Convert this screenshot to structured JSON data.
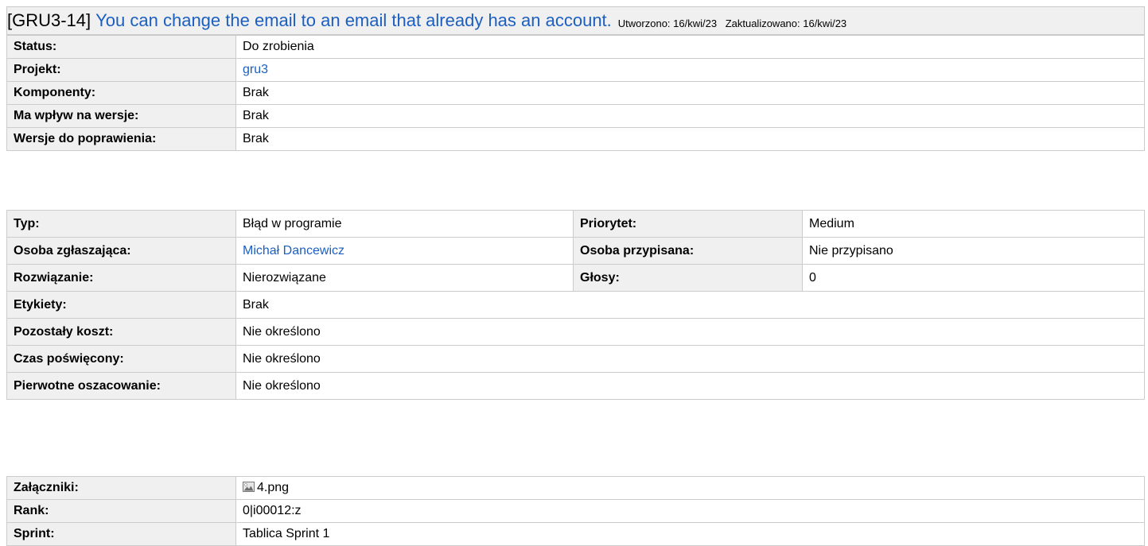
{
  "issue": {
    "key": "[GRU3-14]",
    "summary": "You can change the email to an email that already has an account.",
    "created": "Utworzono: 16/kwi/23",
    "updated": "Zaktualizowano: 16/kwi/23"
  },
  "main_fields": [
    {
      "label": "Status:",
      "value": "Do zrobienia"
    },
    {
      "label": "Projekt:",
      "value": "gru3"
    },
    {
      "label": "Komponenty:",
      "value": "Brak"
    },
    {
      "label": "Ma wpływ na wersje:",
      "value": "Brak"
    },
    {
      "label": "Wersje do poprawienia:",
      "value": "Brak"
    }
  ],
  "details": {
    "typ": {
      "label": "Typ:",
      "value": "Błąd w programie"
    },
    "priorytet": {
      "label": "Priorytet:",
      "value": "Medium"
    },
    "reporter": {
      "label": "Osoba zgłaszająca:",
      "value": "Michał Dancewicz"
    },
    "assignee": {
      "label": "Osoba przypisana:",
      "value": "Nie przypisano"
    },
    "resolution": {
      "label": "Rozwiązanie:",
      "value": "Nierozwiązane"
    },
    "votes": {
      "label": "Głosy:",
      "value": "0"
    },
    "labels": {
      "label": "Etykiety:",
      "value": "Brak"
    },
    "remaining": {
      "label": "Pozostały koszt:",
      "value": "Nie określono"
    },
    "spent": {
      "label": "Czas poświęcony:",
      "value": "Nie określono"
    },
    "original": {
      "label": "Pierwotne oszacowanie:",
      "value": "Nie określono"
    }
  },
  "extra": {
    "attachments": {
      "label": "Załączniki:",
      "value": "4.png",
      "icon": "image-icon"
    },
    "rank": {
      "label": "Rank:",
      "value": "0|i00012:z"
    },
    "sprint": {
      "label": "Sprint:",
      "value": "Tablica Sprint 1"
    }
  },
  "colors": {
    "link": "#1c5fc0",
    "label_bg": "#f0f0f0",
    "border": "#cccccc"
  }
}
